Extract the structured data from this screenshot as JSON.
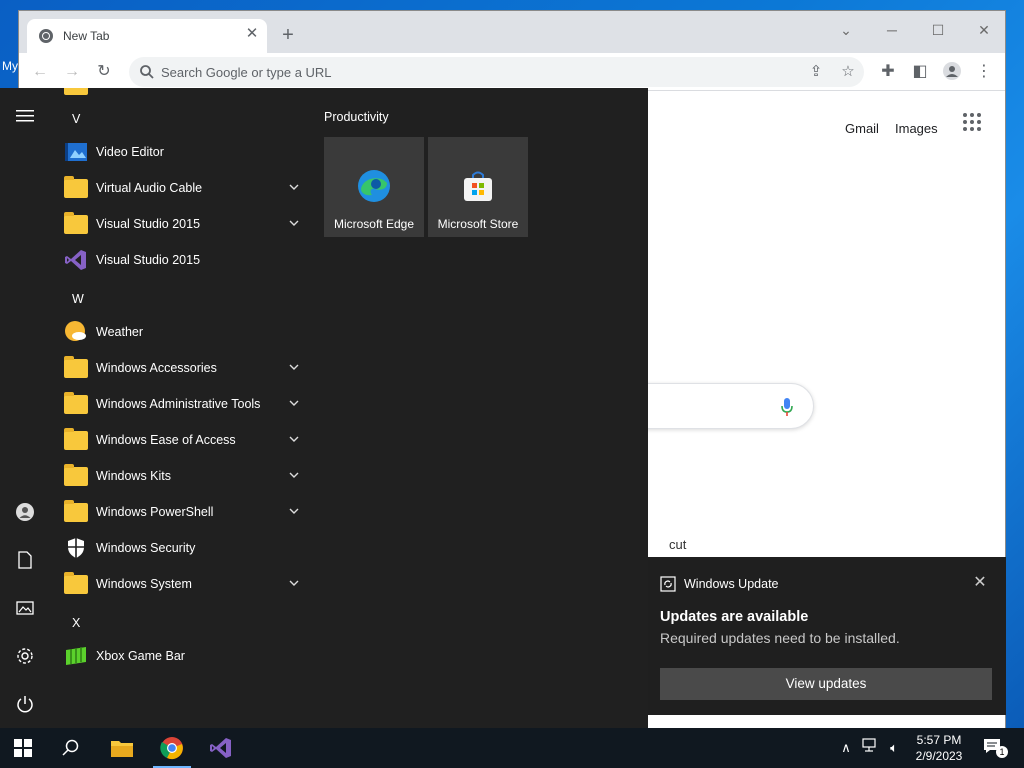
{
  "desktop": {
    "label": "My"
  },
  "browser": {
    "tab_title": "New Tab",
    "tab_close": "✕",
    "new_tab": "+",
    "omnibox_placeholder": "Search Google or type a URL",
    "links": {
      "gmail": "Gmail",
      "images": "Images"
    },
    "partial_text": "cut"
  },
  "start_menu": {
    "group_title": "Productivity",
    "tiles": [
      {
        "label": "Microsoft Edge",
        "icon": "edge-icon"
      },
      {
        "label": "Microsoft Store",
        "icon": "store-icon"
      }
    ],
    "letters": {
      "v": "V",
      "w": "W",
      "x": "X"
    },
    "apps": {
      "video_editor": "Video Editor",
      "virtual_audio_cable": "Virtual Audio Cable",
      "visual_studio_2015_folder": "Visual Studio 2015",
      "visual_studio_2015_app": "Visual Studio 2015",
      "weather": "Weather",
      "windows_accessories": "Windows Accessories",
      "windows_admin_tools": "Windows Administrative Tools",
      "windows_ease_of_access": "Windows Ease of Access",
      "windows_kits": "Windows Kits",
      "windows_powershell": "Windows PowerShell",
      "windows_security": "Windows Security",
      "windows_system": "Windows System",
      "xbox_game_bar": "Xbox Game Bar"
    }
  },
  "notification": {
    "app_name": "Windows Update",
    "title": "Updates are available",
    "body": "Required updates need to be installed.",
    "button": "View updates"
  },
  "taskbar": {
    "time": "5:57 PM",
    "date": "2/9/2023",
    "notification_count": "1"
  },
  "colors": {
    "start_bg": "#202020",
    "taskbar_bg": "#101820",
    "folder": "#f8c83c",
    "desktop": "#0c78d6"
  }
}
